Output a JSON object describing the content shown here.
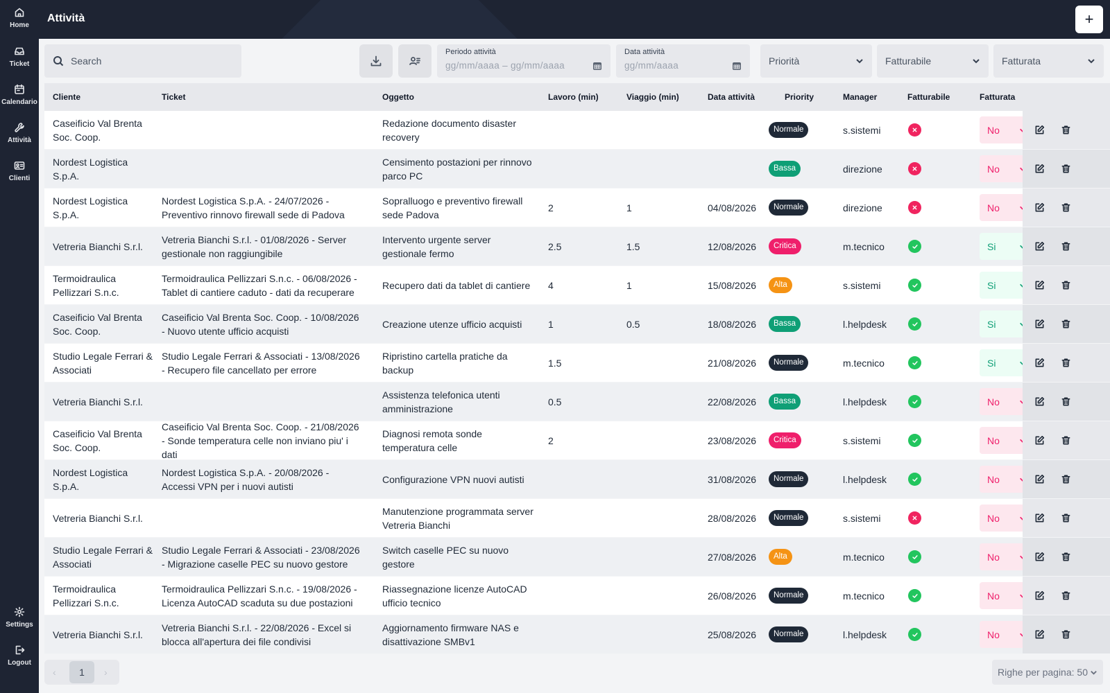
{
  "app": {
    "page_title": "Attività",
    "add_label": "+"
  },
  "sidebar": {
    "items": [
      {
        "label": "Home",
        "icon": "home-icon"
      },
      {
        "label": "Ticket",
        "icon": "inbox-icon"
      },
      {
        "label": "Calendario",
        "icon": "calendar-icon"
      },
      {
        "label": "Attività",
        "icon": "wrench-icon"
      },
      {
        "label": "Clienti",
        "icon": "contacts-icon"
      }
    ],
    "bottom": [
      {
        "label": "Settings",
        "icon": "gear-icon"
      },
      {
        "label": "Logout",
        "icon": "logout-icon"
      }
    ]
  },
  "filters": {
    "search_placeholder": "Search",
    "periodo_label": "Periodo attività",
    "periodo_value": "gg/mm/aaaa – gg/mm/aaaa",
    "data_label": "Data attività",
    "data_value": "gg/mm/aaaa",
    "priorita": "Priorità",
    "fatturabile": "Fatturabile",
    "fatturata": "Fatturata"
  },
  "table": {
    "columns": [
      "Cliente",
      "Ticket",
      "Oggetto",
      "Lavoro (min)",
      "Viaggio (min)",
      "Data attività",
      "Priority",
      "Manager",
      "Fatturabile",
      "Fatturata"
    ],
    "rows": [
      {
        "cliente": "Caseificio Val Brenta Soc. Coop.",
        "ticket": "",
        "oggetto": "Redazione documento disaster recovery",
        "lavoro": "",
        "viaggio": "",
        "data": "",
        "priority": "Normale",
        "manager": "s.sistemi",
        "fatturabile": false,
        "fatturata": "No"
      },
      {
        "cliente": "Nordest Logistica S.p.A.",
        "ticket": "",
        "oggetto": "Censimento postazioni per rinnovo parco PC",
        "lavoro": "",
        "viaggio": "",
        "data": "",
        "priority": "Bassa",
        "manager": "direzione",
        "fatturabile": false,
        "fatturata": "No"
      },
      {
        "cliente": "Nordest Logistica S.p.A.",
        "ticket": "Nordest Logistica S.p.A. - 24/07/2026 - Preventivo rinnovo firewall sede di Padova",
        "oggetto": "Sopralluogo e preventivo firewall sede Padova",
        "lavoro": "2",
        "viaggio": "1",
        "data": "04/08/2026",
        "priority": "Normale",
        "manager": "direzione",
        "fatturabile": false,
        "fatturata": "No"
      },
      {
        "cliente": "Vetreria Bianchi S.r.l.",
        "ticket": "Vetreria Bianchi S.r.l. - 01/08/2026 - Server gestionale non raggiungibile",
        "oggetto": "Intervento urgente server gestionale fermo",
        "lavoro": "2.5",
        "viaggio": "1.5",
        "data": "12/08/2026",
        "priority": "Critica",
        "manager": "m.tecnico",
        "fatturabile": true,
        "fatturata": "Si"
      },
      {
        "cliente": "Termoidraulica Pellizzari S.n.c.",
        "ticket": "Termoidraulica Pellizzari S.n.c. - 06/08/2026 - Tablet di cantiere caduto - dati da recuperare",
        "oggetto": "Recupero dati da tablet di cantiere",
        "lavoro": "4",
        "viaggio": "1",
        "data": "15/08/2026",
        "priority": "Alta",
        "manager": "s.sistemi",
        "fatturabile": true,
        "fatturata": "Si"
      },
      {
        "cliente": "Caseificio Val Brenta Soc. Coop.",
        "ticket": "Caseificio Val Brenta Soc. Coop. - 10/08/2026 - Nuovo utente ufficio acquisti",
        "oggetto": "Creazione utenze ufficio acquisti",
        "lavoro": "1",
        "viaggio": "0.5",
        "data": "18/08/2026",
        "priority": "Bassa",
        "manager": "l.helpdesk",
        "fatturabile": true,
        "fatturata": "Si"
      },
      {
        "cliente": "Studio Legale Ferrari & Associati",
        "ticket": "Studio Legale Ferrari & Associati - 13/08/2026 - Recupero file cancellato per errore",
        "oggetto": "Ripristino cartella pratiche da backup",
        "lavoro": "1.5",
        "viaggio": "",
        "data": "21/08/2026",
        "priority": "Normale",
        "manager": "m.tecnico",
        "fatturabile": true,
        "fatturata": "Si"
      },
      {
        "cliente": "Vetreria Bianchi S.r.l.",
        "ticket": "",
        "oggetto": "Assistenza telefonica utenti amministrazione",
        "lavoro": "0.5",
        "viaggio": "",
        "data": "22/08/2026",
        "priority": "Bassa",
        "manager": "l.helpdesk",
        "fatturabile": true,
        "fatturata": "No"
      },
      {
        "cliente": "Caseificio Val Brenta Soc. Coop.",
        "ticket": "Caseificio Val Brenta Soc. Coop. - 21/08/2026 - Sonde temperatura celle non inviano piu' i dati",
        "oggetto": "Diagnosi remota sonde temperatura celle",
        "lavoro": "2",
        "viaggio": "",
        "data": "23/08/2026",
        "priority": "Critica",
        "manager": "s.sistemi",
        "fatturabile": true,
        "fatturata": "No"
      },
      {
        "cliente": "Nordest Logistica S.p.A.",
        "ticket": "Nordest Logistica S.p.A. - 20/08/2026 - Accessi VPN per i nuovi autisti",
        "oggetto": "Configurazione VPN nuovi autisti",
        "lavoro": "",
        "viaggio": "",
        "data": "31/08/2026",
        "priority": "Normale",
        "manager": "l.helpdesk",
        "fatturabile": true,
        "fatturata": "No"
      },
      {
        "cliente": "Vetreria Bianchi S.r.l.",
        "ticket": "",
        "oggetto": "Manutenzione programmata server Vetreria Bianchi",
        "lavoro": "",
        "viaggio": "",
        "data": "28/08/2026",
        "priority": "Normale",
        "manager": "s.sistemi",
        "fatturabile": false,
        "fatturata": "No"
      },
      {
        "cliente": "Studio Legale Ferrari & Associati",
        "ticket": "Studio Legale Ferrari & Associati - 23/08/2026 - Migrazione caselle PEC su nuovo gestore",
        "oggetto": "Switch caselle PEC su nuovo gestore",
        "lavoro": "",
        "viaggio": "",
        "data": "27/08/2026",
        "priority": "Alta",
        "manager": "m.tecnico",
        "fatturabile": true,
        "fatturata": "No"
      },
      {
        "cliente": "Termoidraulica Pellizzari S.n.c.",
        "ticket": "Termoidraulica Pellizzari S.n.c. - 19/08/2026 - Licenza AutoCAD scaduta su due postazioni",
        "oggetto": "Riassegnazione licenze AutoCAD ufficio tecnico",
        "lavoro": "",
        "viaggio": "",
        "data": "26/08/2026",
        "priority": "Normale",
        "manager": "m.tecnico",
        "fatturabile": true,
        "fatturata": "No"
      },
      {
        "cliente": "Vetreria Bianchi S.r.l.",
        "ticket": "Vetreria Bianchi S.r.l. - 22/08/2026 - Excel si blocca all'apertura dei file condivisi",
        "oggetto": "Aggiornamento firmware NAS e disattivazione SMBv1",
        "lavoro": "",
        "viaggio": "",
        "data": "25/08/2026",
        "priority": "Normale",
        "manager": "l.helpdesk",
        "fatturabile": true,
        "fatturata": "No"
      }
    ]
  },
  "priority_colors": {
    "Normale": "#1f2937",
    "Bassa": "#0f9f76",
    "Critica": "#ef1f6b",
    "Alta": "#f59314"
  },
  "status_colors": {
    "yes": "#22c55e",
    "no": "#f0245f"
  },
  "pagination": {
    "current_page": "1",
    "prev": "‹",
    "next": "›",
    "rows_per_page": "Righe per pagina: 50"
  }
}
